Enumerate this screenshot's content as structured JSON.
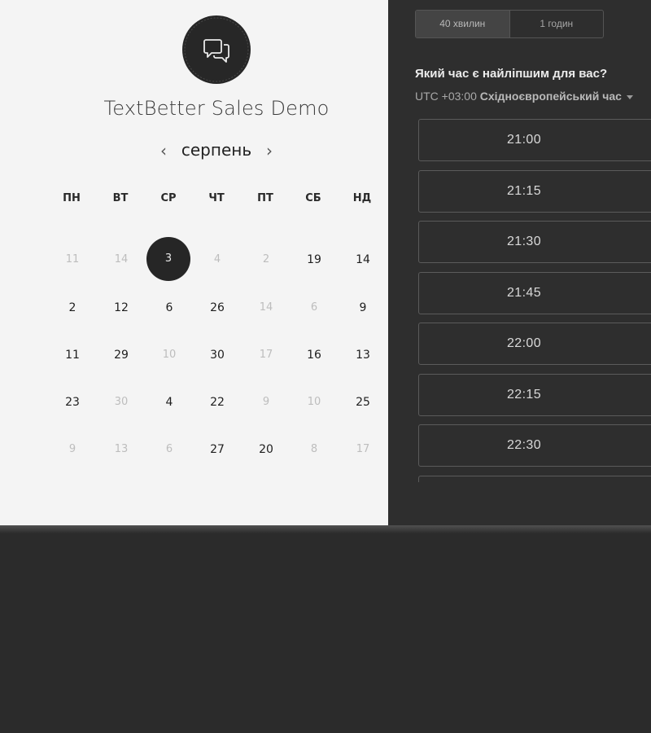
{
  "header": {
    "title": "TextBetter Sales Demo",
    "logo_icon": "chat-bubbles-icon"
  },
  "calendar": {
    "month": "серпень",
    "prev_icon": "chevron-left-icon",
    "prev_glyph": "‹",
    "next_icon": "chevron-right-icon",
    "next_glyph": "›",
    "weekdays": [
      "ПН",
      "ВТ",
      "СР",
      "ЧТ",
      "ПТ",
      "СБ",
      "НД"
    ],
    "weeks": [
      [
        {
          "day": "11",
          "state": "muted"
        },
        {
          "day": "14",
          "state": "muted"
        },
        {
          "day": "3",
          "state": "selected"
        },
        {
          "day": "4",
          "state": "muted"
        },
        {
          "day": "2",
          "state": "muted"
        },
        {
          "day": "19",
          "state": "available"
        },
        {
          "day": "14",
          "state": "available"
        }
      ],
      [
        {
          "day": "2",
          "state": "available"
        },
        {
          "day": "12",
          "state": "available"
        },
        {
          "day": "6",
          "state": "available"
        },
        {
          "day": "26",
          "state": "available"
        },
        {
          "day": "14",
          "state": "muted"
        },
        {
          "day": "6",
          "state": "muted"
        },
        {
          "day": "9",
          "state": "available"
        }
      ],
      [
        {
          "day": "11",
          "state": "available"
        },
        {
          "day": "29",
          "state": "available"
        },
        {
          "day": "10",
          "state": "muted"
        },
        {
          "day": "30",
          "state": "available"
        },
        {
          "day": "17",
          "state": "muted"
        },
        {
          "day": "16",
          "state": "available"
        },
        {
          "day": "13",
          "state": "available"
        }
      ],
      [
        {
          "day": "23",
          "state": "available"
        },
        {
          "day": "30",
          "state": "muted"
        },
        {
          "day": "4",
          "state": "available"
        },
        {
          "day": "22",
          "state": "available"
        },
        {
          "day": "9",
          "state": "muted"
        },
        {
          "day": "10",
          "state": "muted"
        },
        {
          "day": "25",
          "state": "available"
        }
      ],
      [
        {
          "day": "9",
          "state": "muted"
        },
        {
          "day": "13",
          "state": "muted"
        },
        {
          "day": "6",
          "state": "muted"
        },
        {
          "day": "27",
          "state": "available"
        },
        {
          "day": "20",
          "state": "available"
        },
        {
          "day": "8",
          "state": "muted"
        },
        {
          "day": "17",
          "state": "muted"
        }
      ]
    ]
  },
  "scheduler": {
    "durations": [
      {
        "label": "40 хвилин",
        "active": true
      },
      {
        "label": "1 годин",
        "active": false
      }
    ],
    "question": "Який час є найліпшим для вас?",
    "timezone": {
      "offset": "UTC +03:00",
      "name": "Східноєвропейський час",
      "caret_icon": "caret-down-icon"
    },
    "slots": [
      "21:00",
      "21:15",
      "21:30",
      "21:45",
      "22:00",
      "22:15",
      "22:30"
    ]
  },
  "colors": {
    "left_panel_bg": "#f4f4f4",
    "right_panel_bg": "#2e2e2e",
    "selected_day_bg": "#262626",
    "muted_day": "#bdbdbd",
    "slot_border": "#5b5b5b"
  }
}
